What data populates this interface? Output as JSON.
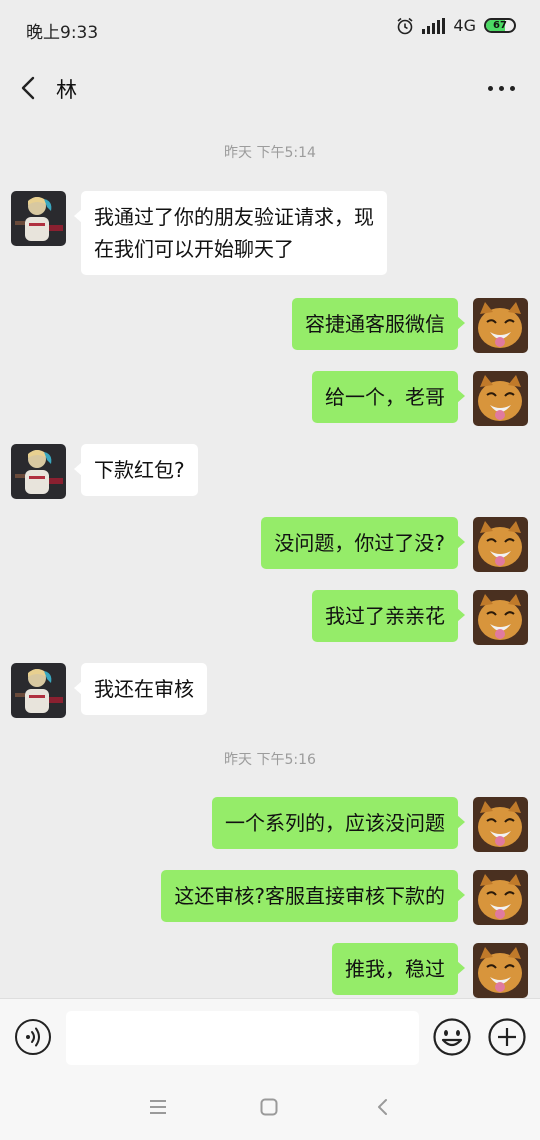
{
  "status_bar": {
    "time": "晚上9:33",
    "network": "4G",
    "battery": "67",
    "battery_level": 0.67,
    "icons": [
      "alarm-icon",
      "signal-icon",
      "battery-icon"
    ]
  },
  "header": {
    "back_icon": "chevron-left-icon",
    "title": "林",
    "more_icon": "more-dots-icon"
  },
  "timestamps": [
    "昨天 下午5:14",
    "昨天 下午5:16"
  ],
  "messages": [
    {
      "side": "left",
      "line1": "我通过了你的朋友验证请求，现",
      "line2": "在我们可以开始聊天了"
    },
    {
      "side": "right",
      "text": "容捷通客服微信"
    },
    {
      "side": "right",
      "text": "给一个，老哥"
    },
    {
      "side": "left",
      "text": "下款红包?"
    },
    {
      "side": "right",
      "text": "没问题，你过了没?"
    },
    {
      "side": "right",
      "text": "我过了亲亲花"
    },
    {
      "side": "left",
      "text": "我还在审核"
    },
    {
      "side": "right",
      "text": "一个系列的，应该没问题"
    },
    {
      "side": "right",
      "text": "这还审核?客服直接审核下款的"
    },
    {
      "side": "right",
      "text": "推我，稳过"
    }
  ],
  "input_bar": {
    "voice_icon": "voice-icon",
    "placeholder": "",
    "emoji_icon": "emoji-icon",
    "plus_icon": "plus-icon"
  },
  "system_nav": [
    "menu-icon",
    "home-icon",
    "back-icon"
  ],
  "colors": {
    "background": "#ededed",
    "sent_bubble": "#95ec69",
    "received_bubble": "#ffffff",
    "timestamp": "#9c9c9c"
  }
}
